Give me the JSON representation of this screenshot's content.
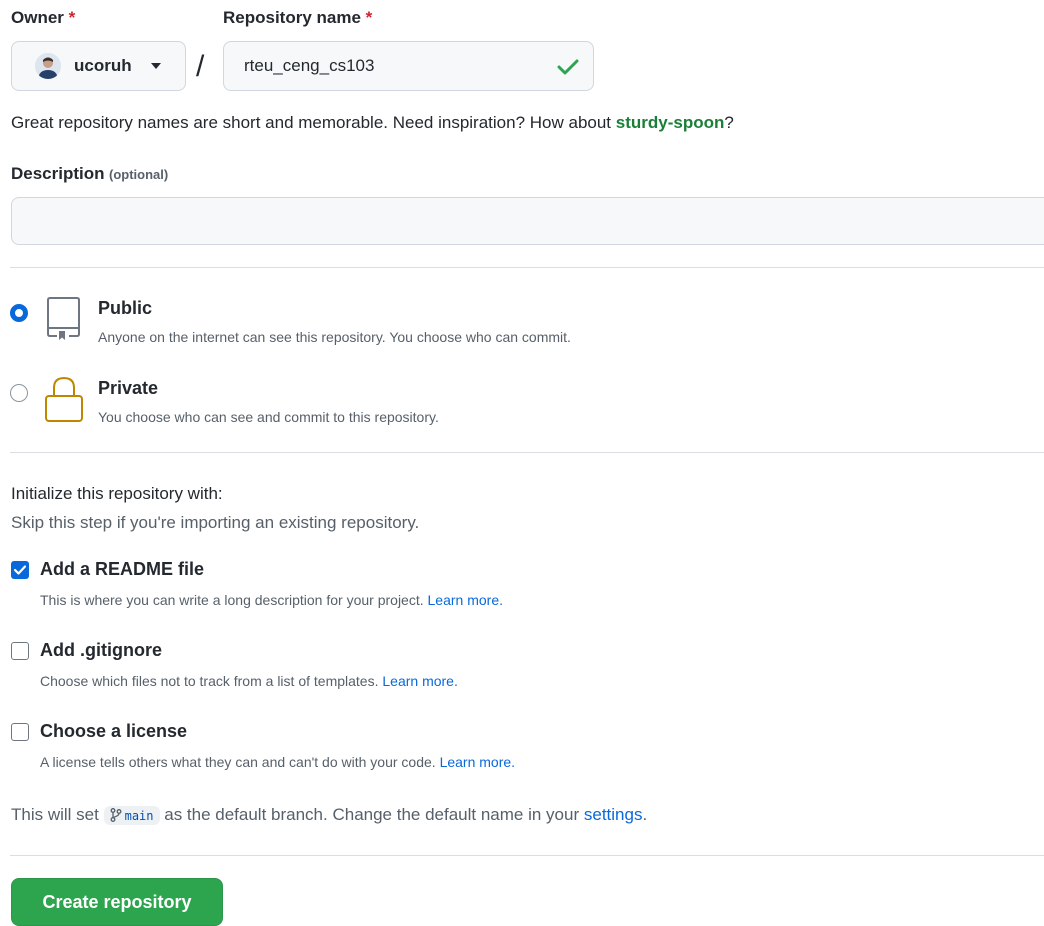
{
  "owner": {
    "label": "Owner",
    "required_mark": "*",
    "value": "ucoruh"
  },
  "repo_name": {
    "label": "Repository name",
    "required_mark": "*",
    "value": "rteu_ceng_cs103",
    "separator": "/"
  },
  "hint": {
    "text": "Great repository names are short and memorable. Need inspiration? How about ",
    "suggestion": "sturdy-spoon",
    "end": "?"
  },
  "description": {
    "label": "Description",
    "optional": "(optional)",
    "value": ""
  },
  "visibility": {
    "public": {
      "title": "Public",
      "desc": "Anyone on the internet can see this repository. You choose who can commit.",
      "selected": true
    },
    "private": {
      "title": "Private",
      "desc": "You choose who can see and commit to this repository.",
      "selected": false
    }
  },
  "init": {
    "heading": "Initialize this repository with:",
    "sub": "Skip this step if you're importing an existing repository.",
    "readme": {
      "label": "Add a README file",
      "desc": "This is where you can write a long description for your project.",
      "link": "Learn more.",
      "checked": true
    },
    "gitignore": {
      "label": "Add .gitignore",
      "desc": "Choose which files not to track from a list of templates.",
      "link": "Learn more.",
      "checked": false
    },
    "license": {
      "label": "Choose a license",
      "desc": "A license tells others what they can and can't do with your code.",
      "link": "Learn more.",
      "checked": false
    }
  },
  "branch": {
    "pre": "This will set",
    "name": "main",
    "post": "as the default branch. Change the default name in your",
    "link": "settings",
    "end": "."
  },
  "create_button": "Create repository",
  "colors": {
    "accent": "#0969da",
    "success": "#2da44e",
    "required": "#cf222e"
  }
}
